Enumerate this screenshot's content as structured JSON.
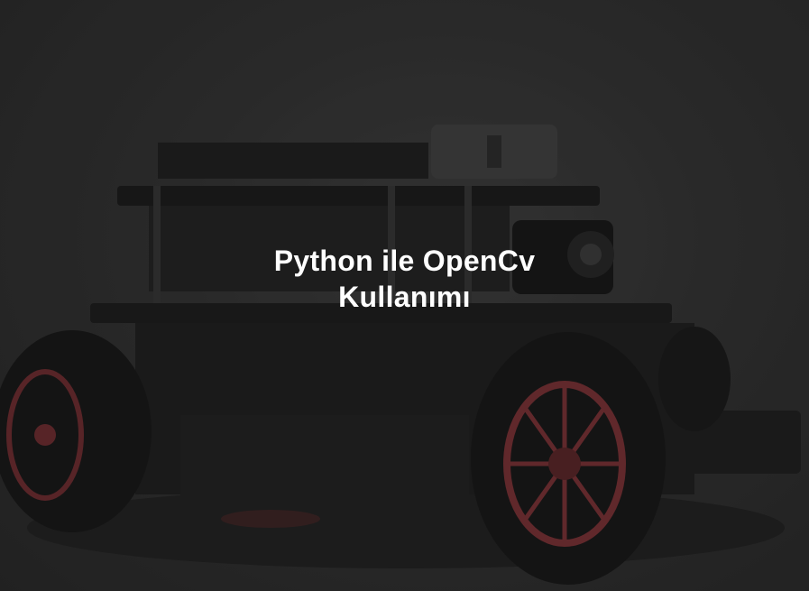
{
  "hero": {
    "title_line1": "Python ile OpenCv",
    "title_line2": "Kullanımı"
  },
  "colors": {
    "overlay": "#2a2a2a",
    "title": "#ffffff",
    "wheel_rim": "#7a2f33"
  }
}
